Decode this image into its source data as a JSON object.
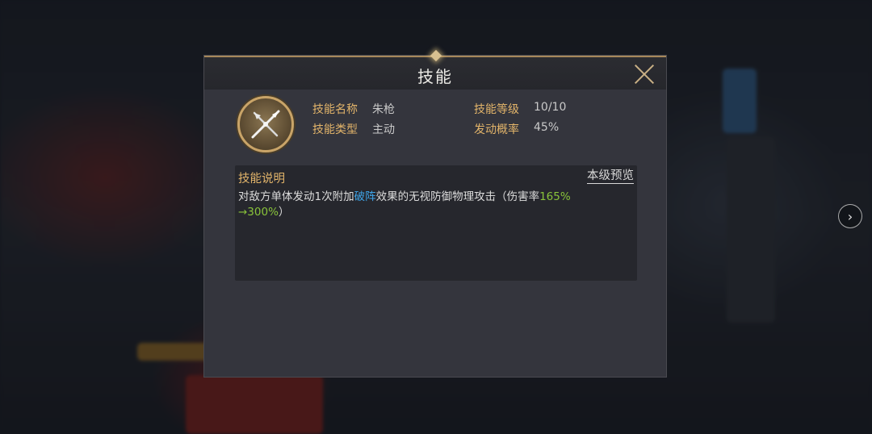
{
  "dialog": {
    "title": "技能",
    "close_icon": "close-icon"
  },
  "skill": {
    "icon": "crossed-spears-icon",
    "name_label": "技能名称",
    "name_value": "朱枪",
    "level_label": "技能等级",
    "level_value": "10/10",
    "type_label": "技能类型",
    "type_value": "主动",
    "chance_label": "发动概率",
    "chance_value": "45%"
  },
  "description": {
    "title": "技能说明",
    "preview_link": "本级预览",
    "text_part1": "对敌方单体发动1次附加",
    "text_highlight": "破阵",
    "text_part2": "效果的无视防御物理攻击（伤害率",
    "text_green1": "165%",
    "text_green2": "→300%",
    "text_part3": "）"
  },
  "nav": {
    "next_icon": "chevron-right-icon",
    "next_glyph": "›"
  },
  "colors": {
    "label_gold": "#e2b46a",
    "highlight_blue": "#3fa6ea",
    "highlight_green": "#89c43a",
    "frame_gold": "#c9a468"
  }
}
